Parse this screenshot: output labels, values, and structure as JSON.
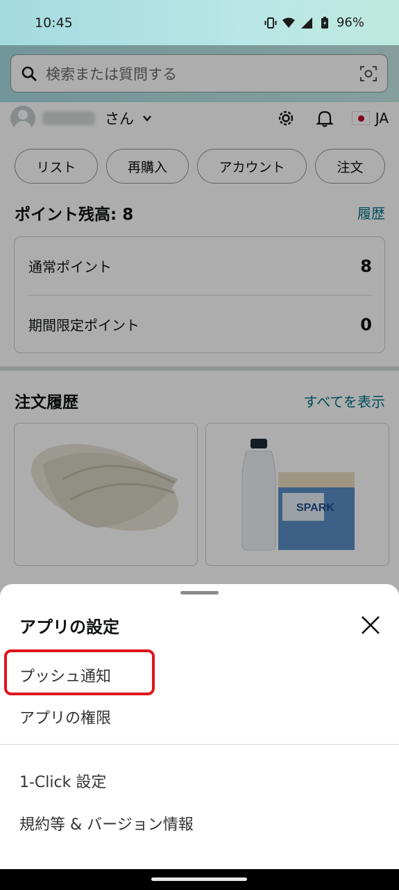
{
  "status_bar": {
    "time": "10:45",
    "battery": "96%"
  },
  "search": {
    "placeholder": "検索または質問する"
  },
  "user": {
    "suffix": "さん",
    "language": "JA"
  },
  "quick_links": [
    "リスト",
    "再購入",
    "アカウント",
    "注文"
  ],
  "points": {
    "title": "ポイント残高: 8",
    "history_link": "履歴",
    "rows": [
      {
        "label": "通常ポイント",
        "value": "8"
      },
      {
        "label": "期間限定ポイント",
        "value": "0"
      }
    ]
  },
  "orders": {
    "title": "注文履歴",
    "see_all": "すべてを表示"
  },
  "sheet": {
    "title": "アプリの設定",
    "items": [
      "プッシュ通知",
      "アプリの権限",
      "1-Click 設定",
      "規約等 & バージョン情報"
    ],
    "highlight_color": "#e0141c"
  },
  "colors": {
    "link": "#007185",
    "header_gradient_start": "#a8dde3",
    "header_gradient_end": "#c5eae8"
  }
}
